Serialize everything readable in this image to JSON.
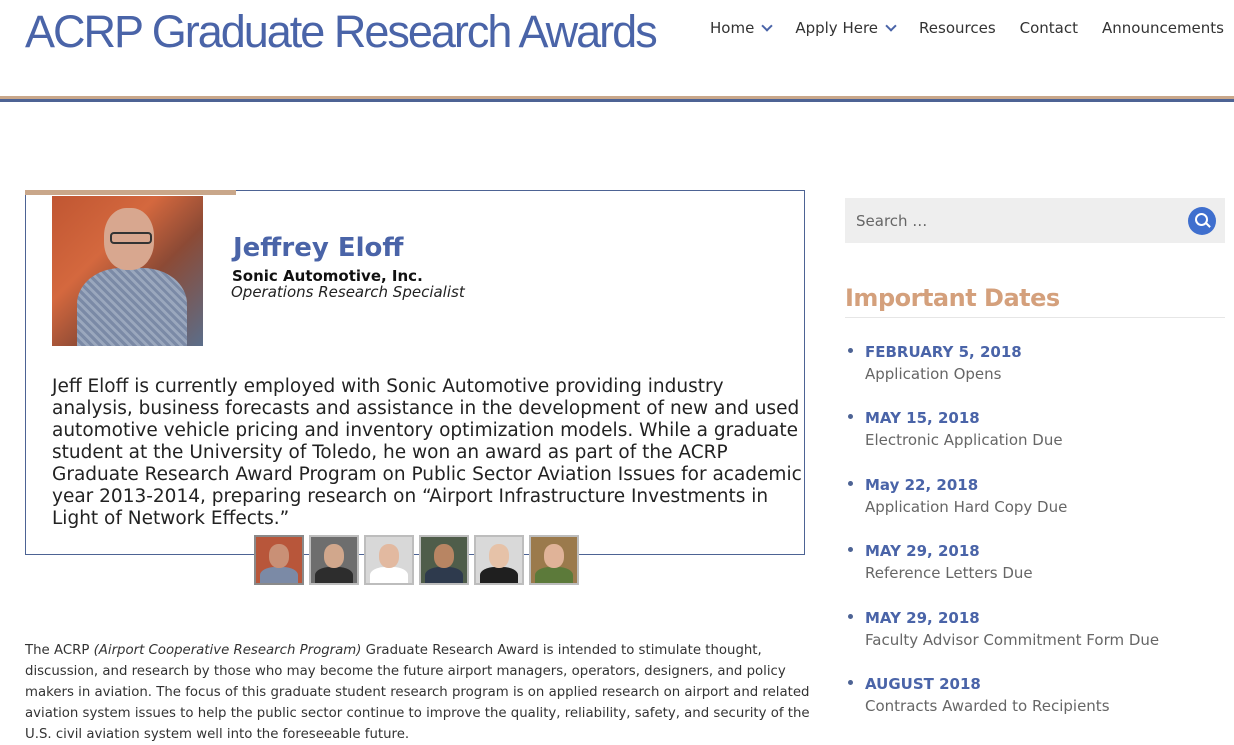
{
  "site": {
    "title": "ACRP Graduate Research Awards"
  },
  "nav": [
    {
      "label": "Home",
      "has_dropdown": true
    },
    {
      "label": "Apply Here",
      "has_dropdown": true
    },
    {
      "label": "Resources",
      "has_dropdown": false
    },
    {
      "label": "Contact",
      "has_dropdown": false
    },
    {
      "label": "Announcements",
      "has_dropdown": false
    }
  ],
  "profile": {
    "name": "Jeffrey Eloff",
    "company": "Sonic Automotive, Inc.",
    "role": "Operations Research Specialist",
    "bio": "Jeff Eloff is currently employed with Sonic Automotive providing industry analysis, business forecasts and assistance in the development of new and used automotive vehicle pricing and inventory optimization models. While a graduate student at the University of Toledo, he won an award as part of the ACRP Graduate Research Award Program on Public Sector Aviation Issues for academic year 2013-2014, preparing research on “Airport Infrastructure Investments in Light of Network Effects.”"
  },
  "thumbnails": [
    {
      "skin": "#c99076",
      "body": "#7b8aa6",
      "bg": "#b8563a"
    },
    {
      "skin": "#d1a78c",
      "body": "#2d2d2d",
      "bg": "#6e6e6e"
    },
    {
      "skin": "#e2b9a0",
      "body": "#ffffff",
      "bg": "#d8d8d8"
    },
    {
      "skin": "#b88563",
      "body": "#2e3a4d",
      "bg": "#4f5d4a"
    },
    {
      "skin": "#e6c2a8",
      "body": "#1f1f1f",
      "bg": "#d9d9d9"
    },
    {
      "skin": "#e0b398",
      "body": "#5c7a3a",
      "bg": "#9b7a4c"
    }
  ],
  "intro": {
    "lead": "The ACRP ",
    "program_name": "(Airport Cooperative Research Program)",
    "text": " Graduate Research Award is intended to stimulate thought, discussion, and research by those who may become the future airport managers, operators, designers, and policy makers in aviation. The focus of this graduate student research program is on applied research on airport and related aviation system issues  to help the public sector continue to improve the quality, reliability, safety, and security of the U.S. civil aviation system well into the foreseeable future."
  },
  "sidebar": {
    "search_placeholder": "Search …",
    "dates_title": "Important Dates",
    "dates": [
      {
        "date": "FEBRUARY 5, 2018",
        "event": "Application Opens"
      },
      {
        "date": "MAY 15, 2018",
        "event": "Electronic Application Due"
      },
      {
        "date": "May 22, 2018",
        "event": "Application Hard Copy Due"
      },
      {
        "date": "MAY 29, 2018",
        "event": "Reference Letters Due"
      },
      {
        "date": "MAY 29, 2018",
        "event": "Faculty Advisor Commitment Form Due"
      },
      {
        "date": "AUGUST 2018",
        "event": "Contracts Awarded to Recipients"
      }
    ]
  },
  "colors": {
    "brand_blue": "#4a64a8",
    "accent_tan": "#c9a78a",
    "search_button": "#3f6fce"
  }
}
